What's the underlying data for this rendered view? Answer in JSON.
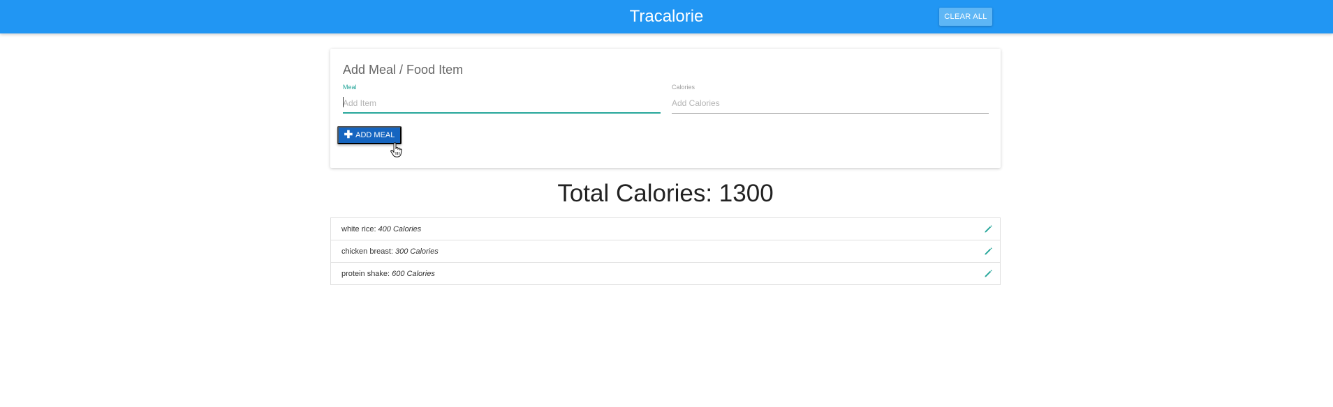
{
  "header": {
    "brand": "Tracalorie",
    "clear_all_label": "CLEAR ALL"
  },
  "form": {
    "title": "Add Meal / Food Item",
    "meal_label": "Meal",
    "meal_placeholder": "Add Item",
    "meal_value": "",
    "calories_label": "Calories",
    "calories_placeholder": "Add Calories",
    "calories_value": "",
    "add_button_label": "ADD MEAL",
    "add_button_icon": "plus-icon"
  },
  "total": {
    "label": "Total Calories: 1300"
  },
  "items": [
    {
      "name": "white rice:",
      "calories": "400 Calories",
      "icon": "pencil-icon"
    },
    {
      "name": "chicken breast:",
      "calories": "300 Calories",
      "icon": "pencil-icon"
    },
    {
      "name": "protein shake:",
      "calories": "600 Calories",
      "icon": "pencil-icon"
    }
  ],
  "colors": {
    "navbar": "#2196f3",
    "clear_button": "#5eb6f5",
    "add_button": "#1565c0",
    "accent_teal": "#26a69a"
  }
}
